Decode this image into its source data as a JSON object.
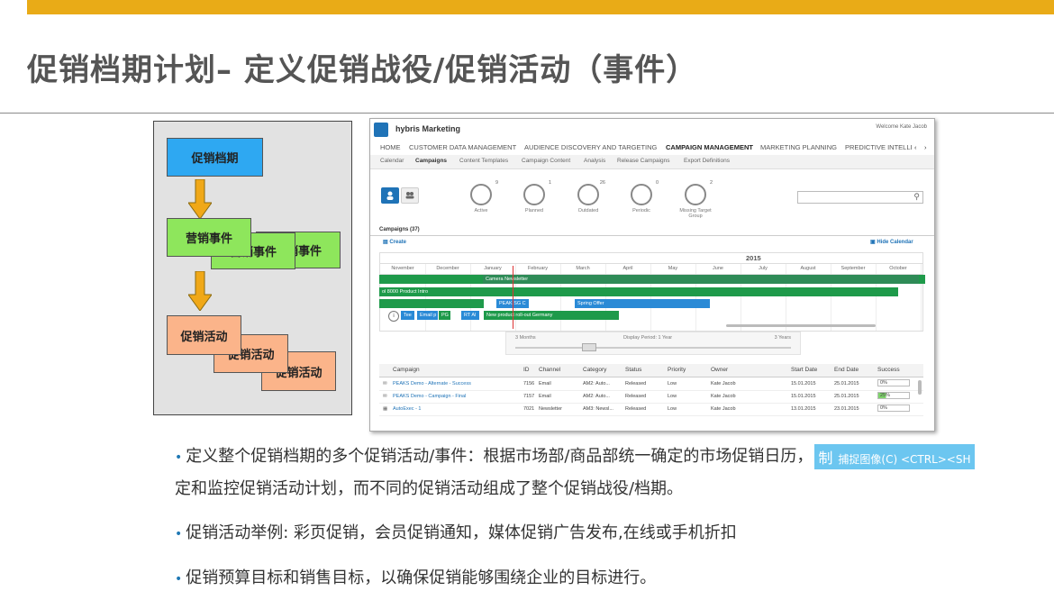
{
  "title": "促销档期计划– 定义促销战役/促销活动（事件）",
  "diagram": {
    "top_box": "促销档期",
    "event_boxes": [
      "营销事件",
      "营销事件",
      "营销事件"
    ],
    "activity_boxes": [
      "促销活动",
      "促销活动",
      "促销活动"
    ]
  },
  "app": {
    "name": "hybris Marketing",
    "welcome": "Welcome Kate Jacob",
    "nav": [
      "HOME",
      "CUSTOMER DATA MANAGEMENT",
      "AUDIENCE DISCOVERY AND TARGETING",
      "CAMPAIGN MANAGEMENT",
      "MARKETING PLANNING",
      "PREDICTIVE INTELLI"
    ],
    "subnav": [
      "Calendar",
      "Campaigns",
      "Content Templates",
      "Campaign Content",
      "Analysis",
      "Release Campaigns",
      "Export Definitions"
    ],
    "kpis": [
      {
        "label": "Active",
        "count": "9"
      },
      {
        "label": "Planned",
        "count": "1"
      },
      {
        "label": "Outdated",
        "count": "26"
      },
      {
        "label": "Periodic",
        "count": "0"
      },
      {
        "label": "Missing Target Group",
        "count": "2"
      }
    ],
    "campaigns_count": "Campaigns (37)",
    "create": "Create",
    "hide_calendar": "Hide Calendar",
    "year": "2015",
    "months": [
      "November",
      "December",
      "January",
      "February",
      "March",
      "April",
      "May",
      "June",
      "July",
      "August",
      "September",
      "October"
    ],
    "bars": [
      {
        "label": "Camera Newsletter"
      },
      {
        "label": "ol 8000 Product Intro"
      },
      {
        "label": "PEAK SG C"
      },
      {
        "label": "Spring Offer"
      },
      {
        "label": "Tee"
      },
      {
        "label": "Email p"
      },
      {
        "label": "PG"
      },
      {
        "label": "RT Al"
      },
      {
        "label": "New product roll-out Germany"
      }
    ],
    "slider": {
      "min": "3 Months",
      "mid": "Display Period: 1 Year",
      "max": "3 Years"
    },
    "table_headers": [
      "Campaign",
      "ID",
      "Channel",
      "Category",
      "Status",
      "Priority",
      "Owner",
      "Start Date",
      "End Date",
      "Success"
    ],
    "rows": [
      [
        "PEAKS Demo - Alternate - Success",
        "7156",
        "Email",
        "AM2: Auto...",
        "Released",
        "Low",
        "Kate Jacob",
        "15.01.2015",
        "25.01.2015",
        "0%"
      ],
      [
        "PEAKS Demo - Campaign - Final",
        "7157",
        "Email",
        "AM2: Auto...",
        "Released",
        "Low",
        "Kate Jacob",
        "15.01.2015",
        "25.01.2015",
        "25%"
      ],
      [
        "AutoExec - 1",
        "7021",
        "Newsletter",
        "AM3: Newsl...",
        "Released",
        "Low",
        "Kate Jacob",
        "13.01.2015",
        "23.01.2015",
        "0%"
      ]
    ]
  },
  "bullets": {
    "b1_line1": "定义整个促销档期的多个促销活动/事件：根据市场部/商品部统一确定的市场促销日历，",
    "b1_line2": "定和监控促销活动计划，而不同的促销活动组成了整个促销战役/档期。",
    "badge_char": "制",
    "badge_text": "捕捉图像(C)   <CTRL><SH",
    "b2": "促销活动举例:  彩页促销，会员促销通知，媒体促销广告发布,在线或手机折扣",
    "b3": "促销预算目标和销售目标，以确保促销能够围绕企业的目标进行。"
  },
  "colors": {
    "accent": "#e9ab17",
    "blue_box": "#2ea8f2",
    "green_box": "#8ee65c",
    "orange_box": "#fbb48a",
    "bar_green": "#1e9a4a",
    "bar_blue": "#2a8ad6"
  }
}
